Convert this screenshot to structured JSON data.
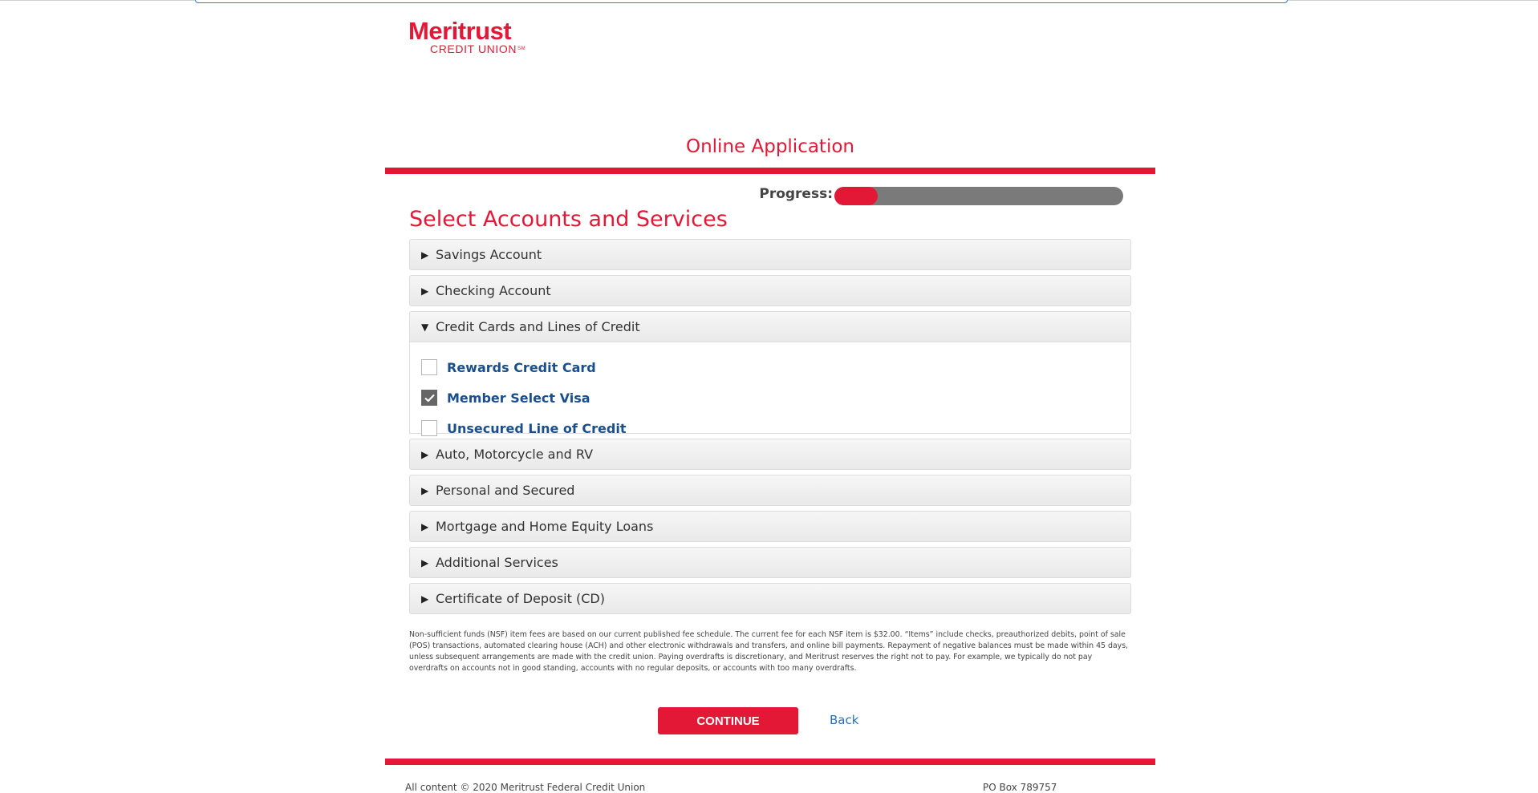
{
  "brand": {
    "logo_main": "Meritrust",
    "logo_sub": "CREDIT UNION",
    "logo_mark": "SM",
    "accent_color": "#e31837"
  },
  "page": {
    "title": "Online Application",
    "section_title": "Select Accounts and Services"
  },
  "progress": {
    "label": "Progress:",
    "percent": 15
  },
  "accordion": {
    "items": [
      {
        "label": "Savings Account",
        "open": false
      },
      {
        "label": "Checking Account",
        "open": false
      },
      {
        "label": "Credit Cards and Lines of Credit",
        "open": true,
        "options": [
          {
            "label": "Rewards Credit Card",
            "checked": false
          },
          {
            "label": "Member Select Visa",
            "checked": true
          },
          {
            "label": "Unsecured Line of Credit",
            "checked": false
          }
        ]
      },
      {
        "label": "Auto, Motorcycle and RV",
        "open": false
      },
      {
        "label": "Personal and Secured",
        "open": false
      },
      {
        "label": "Mortgage and Home Equity Loans",
        "open": false
      },
      {
        "label": "Additional Services",
        "open": false
      },
      {
        "label": "Certificate of Deposit (CD)",
        "open": false
      }
    ]
  },
  "disclaimer": "Non-sufficient funds (NSF) item fees are based on our current published fee schedule. The current fee for each NSF item is $32.00. “Items” include checks, preauthorized debits, point of sale (POS) transactions, automated clearing house (ACH) and other electronic withdrawals and transfers, and online bill payments. Repayment of negative balances must be made within 45 days, unless subsequent arrangements are made with the credit union. Paying overdrafts is discretionary, and Meritrust reserves the right not to pay. For example, we typically do not pay overdrafts on accounts not in good standing, accounts with no regular deposits, or accounts with too many overdrafts.",
  "actions": {
    "continue_label": "CONTINUE",
    "back_label": "Back"
  },
  "footer": {
    "copyright": "All content © 2020 Meritrust Federal Credit Union",
    "address": "PO Box 789757"
  }
}
